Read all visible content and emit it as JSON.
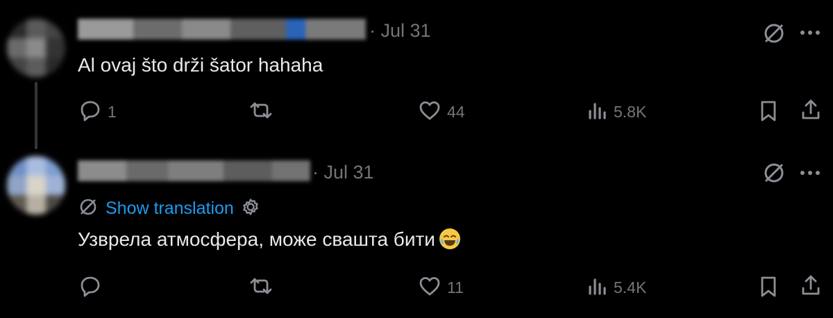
{
  "tweets": [
    {
      "timestamp": "· Jul 31",
      "text": "Al ovaj što drži šator hahaha",
      "actions": {
        "replies": "1",
        "retweets": "",
        "likes": "44",
        "views": "5.8K"
      }
    },
    {
      "timestamp": "· Jul 31",
      "translate_label": "Show translation",
      "text": "Узврела атмосфера, може свашта бити",
      "emoji": "face-with-tears-of-joy-emoji",
      "actions": {
        "replies": "",
        "retweets": "",
        "likes": "11",
        "views": "5.4K"
      }
    }
  ],
  "icons": {
    "grok": "grok-icon",
    "more": "more-icon",
    "reply": "reply-icon",
    "retweet": "retweet-icon",
    "like": "like-icon",
    "views": "views-icon",
    "bookmark": "bookmark-icon",
    "share": "share-icon",
    "translate": "translate-icon",
    "settings": "gear-icon"
  },
  "colors": {
    "background": "#000000",
    "text": "#e7e9ea",
    "muted": "#71767b",
    "link": "#1d9bf0"
  }
}
